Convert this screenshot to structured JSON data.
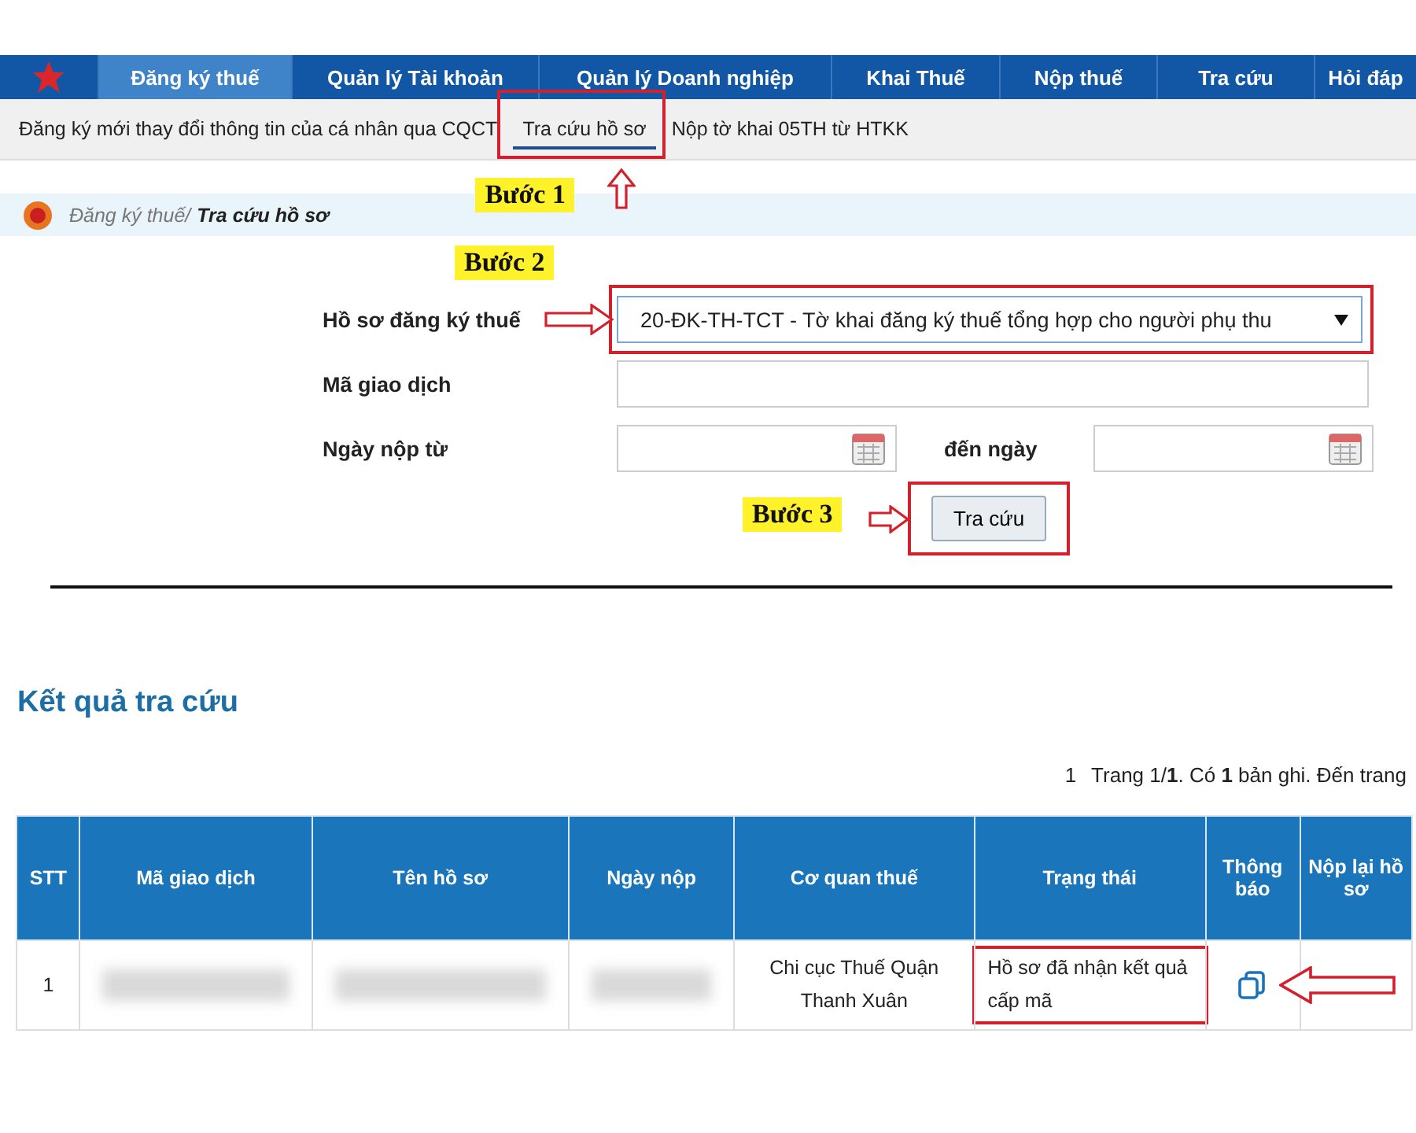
{
  "nav": {
    "items": [
      {
        "label": "Đăng ký thuế",
        "selected": true
      },
      {
        "label": "Quản lý Tài khoản",
        "selected": false
      },
      {
        "label": "Quản lý Doanh nghiệp",
        "selected": false
      },
      {
        "label": "Khai Thuế",
        "selected": false
      },
      {
        "label": "Nộp thuế",
        "selected": false
      },
      {
        "label": "Tra cứu",
        "selected": false
      },
      {
        "label": "Hỏi đáp",
        "selected": false
      }
    ]
  },
  "subnav": {
    "items": [
      {
        "label": "Đăng ký mới thay đổi thông tin của cá nhân qua CQCT",
        "selected": false
      },
      {
        "label": "Tra cứu hồ sơ",
        "selected": true,
        "callout": "Bước 1"
      },
      {
        "label": "Nộp tờ khai 05TH từ HTKK",
        "selected": false
      }
    ]
  },
  "breadcrumb": {
    "parent": "Đăng ký thuế/",
    "current": "Tra cứu hồ sơ"
  },
  "form": {
    "record_type": {
      "label": "Hồ sơ đăng ký thuế",
      "value": "20-ĐK-TH-TCT - Tờ khai đăng ký thuế tổng hợp cho người phụ thu",
      "callout": "Bước 2"
    },
    "transaction_code": {
      "label": "Mã giao dịch"
    },
    "date_from": {
      "label": "Ngày nộp từ"
    },
    "date_to": {
      "label": "đến ngày"
    },
    "search_button": {
      "label": "Tra cứu",
      "callout": "Bước 3"
    }
  },
  "results": {
    "title": "Kết quả tra cứu",
    "page_link": "1",
    "pagination": "Trang 1/**1**. Có **1** bản ghi. Đến trang",
    "columns": [
      "STT",
      "Mã giao dịch",
      "Tên hồ sơ",
      "Ngày nộp",
      "Cơ quan thuế",
      "Trạng thái",
      "Thông báo",
      "Nộp lại hồ sơ"
    ],
    "rows": [
      {
        "cells": [
          {
            "kind": "text",
            "text": "1"
          },
          {
            "kind": "blurred"
          },
          {
            "kind": "blurred"
          },
          {
            "kind": "blurred"
          },
          {
            "kind": "text",
            "text": "Chi cục Thuế Quận Thanh Xuân"
          },
          {
            "kind": "text",
            "text": "Hồ sơ đã nhận kết quả cấp mã",
            "highlighted": true
          },
          {
            "kind": "icon",
            "pointer": true
          },
          {
            "kind": "empty"
          }
        ]
      }
    ]
  }
}
